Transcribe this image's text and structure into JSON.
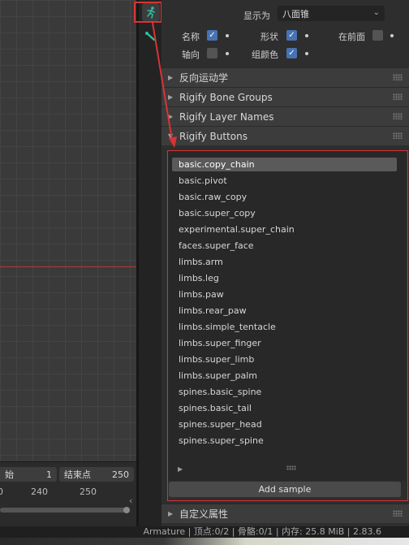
{
  "toolbar": {
    "pose_icon": "armature-pose-icon",
    "bone_icon": "bone-icon"
  },
  "display": {
    "display_as_label": "显示为",
    "display_as_value": "八面锥",
    "name_label": "名称",
    "name_checked": true,
    "shape_label": "形状",
    "shape_checked": true,
    "in_front_label": "在前面",
    "in_front_checked": false,
    "axes_label": "轴向",
    "axes_checked": false,
    "group_colors_label": "组颜色",
    "group_colors_checked": true
  },
  "sections": [
    {
      "label": "反向运动学"
    },
    {
      "label": "Rigify Bone Groups"
    },
    {
      "label": "Rigify Layer Names"
    },
    {
      "label": "Rigify Buttons"
    }
  ],
  "samples": [
    "basic.copy_chain",
    "basic.pivot",
    "basic.raw_copy",
    "basic.super_copy",
    "experimental.super_chain",
    "faces.super_face",
    "limbs.arm",
    "limbs.leg",
    "limbs.paw",
    "limbs.rear_paw",
    "limbs.simple_tentacle",
    "limbs.super_finger",
    "limbs.super_limb",
    "limbs.super_palm",
    "spines.basic_spine",
    "spines.basic_tail",
    "spines.super_head",
    "spines.super_spine"
  ],
  "selected_sample": "basic.copy_chain",
  "add_sample_label": "Add sample",
  "custom_props_label": "自定义属性",
  "timeline": {
    "start_label": "始",
    "start_value": "1",
    "end_label": "结束点",
    "end_value": "250",
    "tick_240": "240",
    "tick_250": "250"
  },
  "status_bar": "Armature | 顶点:0/2 | 骨骼:0/1 | 内存: 25.8 MiB | 2.83.6",
  "colors": {
    "highlight_red": "#d83434",
    "checkbox_blue": "#4772b3",
    "accent_green": "#2fbf9a"
  }
}
